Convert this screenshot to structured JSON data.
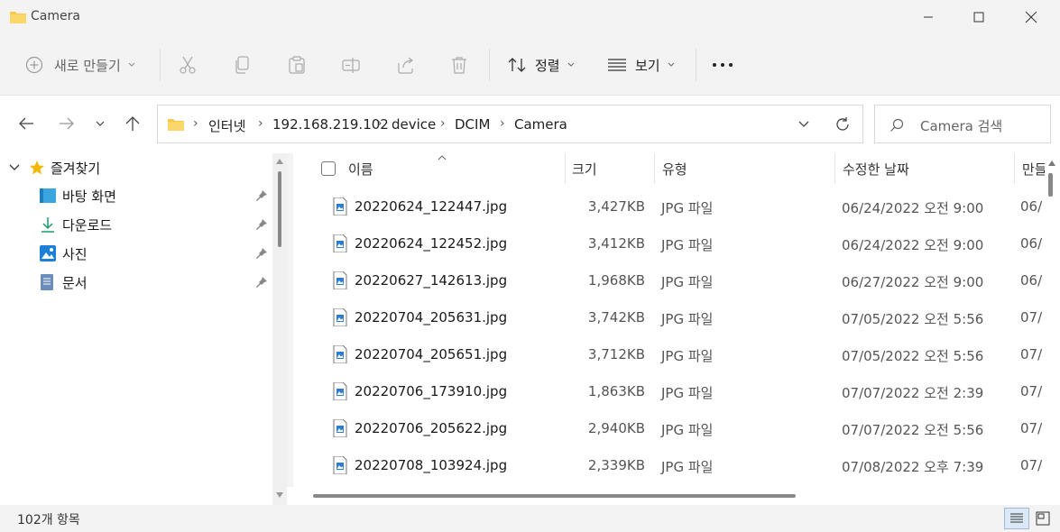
{
  "window": {
    "title": "Camera"
  },
  "toolbar": {
    "new_label": "새로 만들기",
    "sort_label": "정렬",
    "view_label": "보기"
  },
  "address": {
    "crumbs": [
      "인터넷",
      "192.168.219.102",
      "device",
      "DCIM",
      "Camera"
    ]
  },
  "search": {
    "placeholder": "Camera 검색"
  },
  "sidebar": {
    "favorites_label": "즐겨찾기",
    "items": [
      {
        "label": "바탕 화면"
      },
      {
        "label": "다운로드"
      },
      {
        "label": "사진"
      },
      {
        "label": "문서"
      }
    ]
  },
  "columns": {
    "name": "이름",
    "size": "크기",
    "type": "유형",
    "modified": "수정한 날짜",
    "created": "만들"
  },
  "files": [
    {
      "name": "20220624_122447.jpg",
      "size": "3,427KB",
      "type": "JPG 파일",
      "modified": "06/24/2022 오전 9:00",
      "created": "06/"
    },
    {
      "name": "20220624_122452.jpg",
      "size": "3,412KB",
      "type": "JPG 파일",
      "modified": "06/24/2022 오전 9:00",
      "created": "06/"
    },
    {
      "name": "20220627_142613.jpg",
      "size": "1,968KB",
      "type": "JPG 파일",
      "modified": "06/27/2022 오전 9:00",
      "created": "06/"
    },
    {
      "name": "20220704_205631.jpg",
      "size": "3,742KB",
      "type": "JPG 파일",
      "modified": "07/05/2022 오전 5:56",
      "created": "07/"
    },
    {
      "name": "20220704_205651.jpg",
      "size": "3,712KB",
      "type": "JPG 파일",
      "modified": "07/05/2022 오전 5:56",
      "created": "07/"
    },
    {
      "name": "20220706_173910.jpg",
      "size": "1,863KB",
      "type": "JPG 파일",
      "modified": "07/07/2022 오전 2:39",
      "created": "07/"
    },
    {
      "name": "20220706_205622.jpg",
      "size": "2,940KB",
      "type": "JPG 파일",
      "modified": "07/07/2022 오전 5:56",
      "created": "07/"
    },
    {
      "name": "20220708_103924.jpg",
      "size": "2,339KB",
      "type": "JPG 파일",
      "modified": "07/08/2022 오후 7:39",
      "created": "07/"
    }
  ],
  "status": {
    "count": "102개 항목"
  },
  "colors": {
    "accent": "#0067c0",
    "folder": "#f7c94a"
  }
}
